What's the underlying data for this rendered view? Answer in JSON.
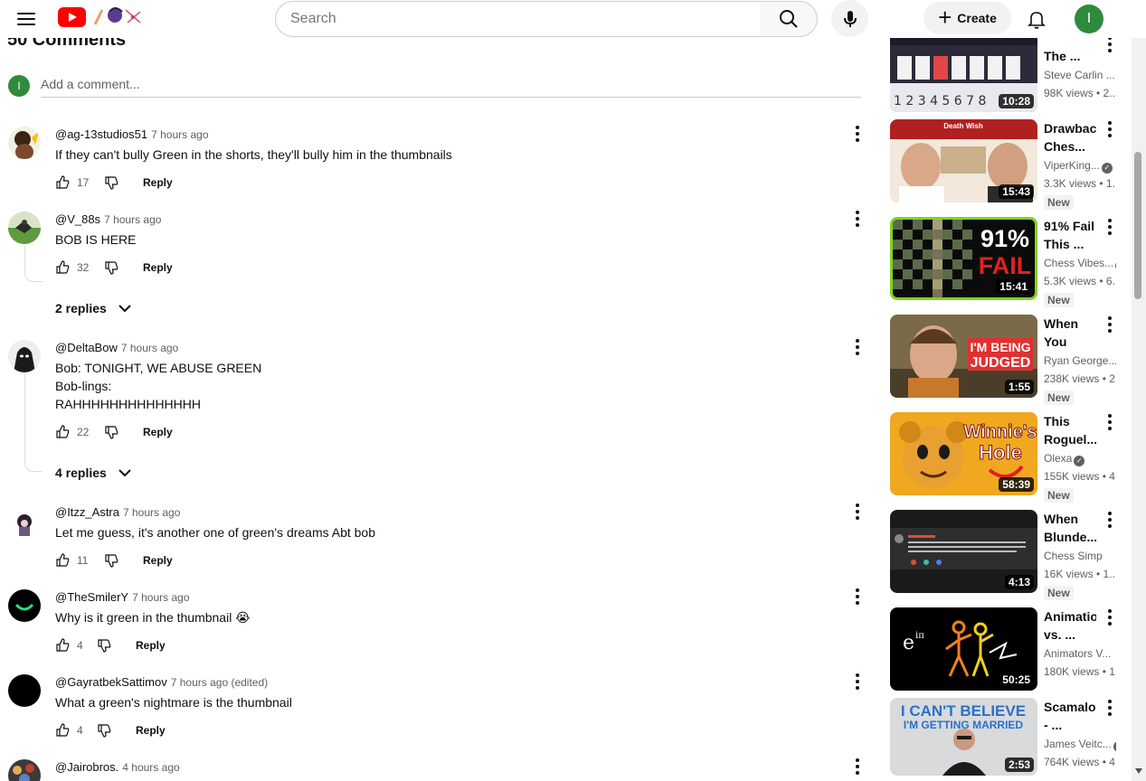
{
  "header": {
    "search_placeholder": "Search",
    "create_label": "Create",
    "avatar_letter": "I"
  },
  "comments": {
    "heading": "50 Comments",
    "add_placeholder": "Add a comment...",
    "reply_label": "Reply",
    "items": [
      {
        "user": "@ag-13studios51",
        "time": "7 hours ago",
        "text": "If they can't bully Green in the shorts, they'll bully him in the thumbnails",
        "likes": "17"
      },
      {
        "user": "@V_88s",
        "time": "7 hours ago",
        "text": "BOB IS HERE",
        "likes": "32",
        "replies": "2 replies"
      },
      {
        "user": "@DeltaBow",
        "time": "7 hours ago",
        "text": "Bob: TONIGHT, WE ABUSE GREEN\nBob-lings:\nRAHHHHHHHHHHHHHH",
        "likes": "22",
        "replies": "4 replies"
      },
      {
        "user": "@Itzz_Astra",
        "time": "7 hours ago",
        "text": "Let me guess, it's another one of green's dreams Abt bob",
        "likes": "11"
      },
      {
        "user": "@TheSmilerY",
        "time": "7 hours ago",
        "text": "Why is it green in the thumbnail 😭",
        "likes": "4"
      },
      {
        "user": "@GayratbekSattimov",
        "time": "7 hours ago (edited)",
        "text": "What a green's nightmare is the thumbnail",
        "likes": "4"
      },
      {
        "user": "@Jairobros.",
        "time": "4 hours ago",
        "text": "",
        "likes": ""
      }
    ]
  },
  "sidebar": {
    "new_label": "New",
    "items": [
      {
        "title": "The ...",
        "channel": "Steve Carlin ...",
        "meta": "98K views • 2...",
        "duration": "10:28",
        "new": false,
        "verified": false
      },
      {
        "title": "Drawback Ches...",
        "channel": "ViperKing...",
        "meta": "3.3K views • 1...",
        "duration": "15:43",
        "new": true,
        "verified": true
      },
      {
        "title": "91% Fail This ...",
        "channel": "Chess Vibes...",
        "meta": "5.3K views • 6...",
        "duration": "15:41",
        "new": true,
        "verified": true
      },
      {
        "title": "When You Ea...",
        "channel": "Ryan George...",
        "meta": "238K views • 2",
        "duration": "1:55",
        "new": true,
        "verified": true
      },
      {
        "title": "This Roguel...",
        "channel": "Olexa",
        "meta": "155K views • 4",
        "duration": "58:39",
        "new": true,
        "verified": true
      },
      {
        "title": "When Blunde...",
        "channel": "Chess Simp",
        "meta": "16K views • 1...",
        "duration": "4:13",
        "new": true,
        "verified": false
      },
      {
        "title": "Animation vs. ...",
        "channel": "Animators V...",
        "meta": "180K views • 1",
        "duration": "50:25",
        "new": false,
        "verified": false
      },
      {
        "title": "Scamalot - ...",
        "channel": "James Veitc...",
        "meta": "764K views • 4",
        "duration": "2:53",
        "new": false,
        "verified": true
      }
    ],
    "thumb_texts": {
      "fail_pct": "91%",
      "fail_word": "FAIL",
      "judged_1": "I'M BEING",
      "judged_2": "JUDGED",
      "winnie_1": "Winnie's",
      "winnie_2": "Hole",
      "death_wish": "Death Wish",
      "cant_believe_1": "I CAN'T BELIEVE",
      "cant_believe_2": "I'M GETTING MARRIED",
      "chess_numbers": "1 2 3 4 5 6 7 8"
    }
  },
  "colors": {
    "brand_red": "#ff0000",
    "avatar_green": "#2e8b3c",
    "text_secondary": "#606060"
  }
}
